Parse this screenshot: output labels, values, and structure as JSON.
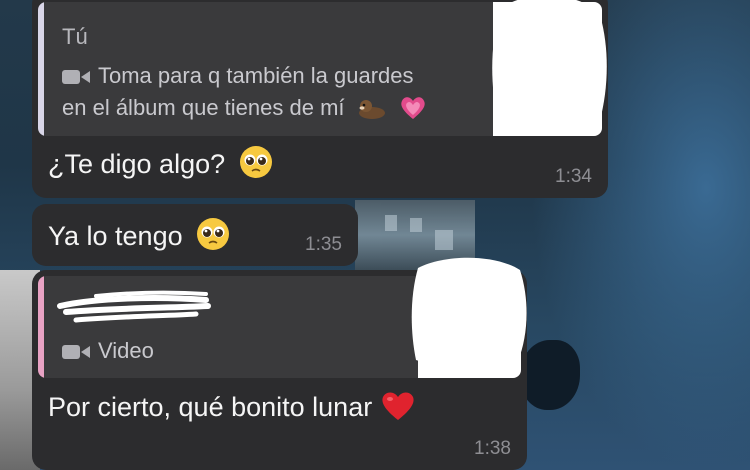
{
  "messages": [
    {
      "quoted": {
        "sender": "Tú",
        "line1": "Toma para q también la guardes",
        "line2": "en el álbum que tienes de mí",
        "media_icon": "video-camera-icon",
        "emojis": [
          "otter-emoji",
          "pink-heart-emoji"
        ],
        "bar_color": "#d9d6e8"
      },
      "text": "¿Te digo algo?",
      "emoji": "pleading-face-emoji",
      "time": "1:34"
    },
    {
      "text": "Ya lo tengo",
      "emoji": "pleading-face-emoji",
      "time": "1:35"
    },
    {
      "quoted": {
        "sender_redacted": true,
        "media_label": "Video",
        "media_icon": "video-camera-icon",
        "bar_color": "#e8a2c4"
      },
      "text": "Por cierto, qué bonito lunar",
      "emoji": "red-heart-emoji",
      "time": "1:38"
    }
  ]
}
